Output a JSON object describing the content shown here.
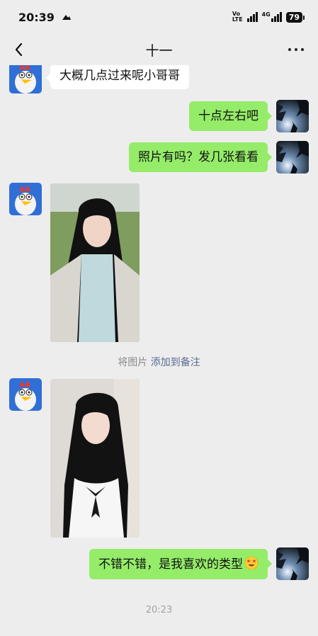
{
  "status_bar": {
    "time": "20:39",
    "network_label_top": "Vo",
    "network_label_bottom": "LTE",
    "network_4g": "4G",
    "battery": "79"
  },
  "nav": {
    "title": "十一"
  },
  "messages": [
    {
      "from": "contact",
      "type": "text",
      "text": "大概几点过来呢小哥哥"
    },
    {
      "from": "me",
      "type": "text",
      "text": "十点左右吧"
    },
    {
      "from": "me",
      "type": "text",
      "text": "照片有吗？发几张看看"
    },
    {
      "from": "contact",
      "type": "image"
    },
    {
      "from": "contact",
      "type": "image"
    },
    {
      "from": "me",
      "type": "text",
      "text": "不错不错，是我喜欢的类型",
      "emoji": "star-struck-emoji"
    }
  ],
  "system_note": {
    "prefix": "将图片",
    "link": "添加到备注"
  },
  "timestamp": "20:23",
  "colors": {
    "background": "#ededed",
    "outgoing_bubble": "#95ec69",
    "incoming_bubble": "#ffffff",
    "link": "#576b95"
  }
}
